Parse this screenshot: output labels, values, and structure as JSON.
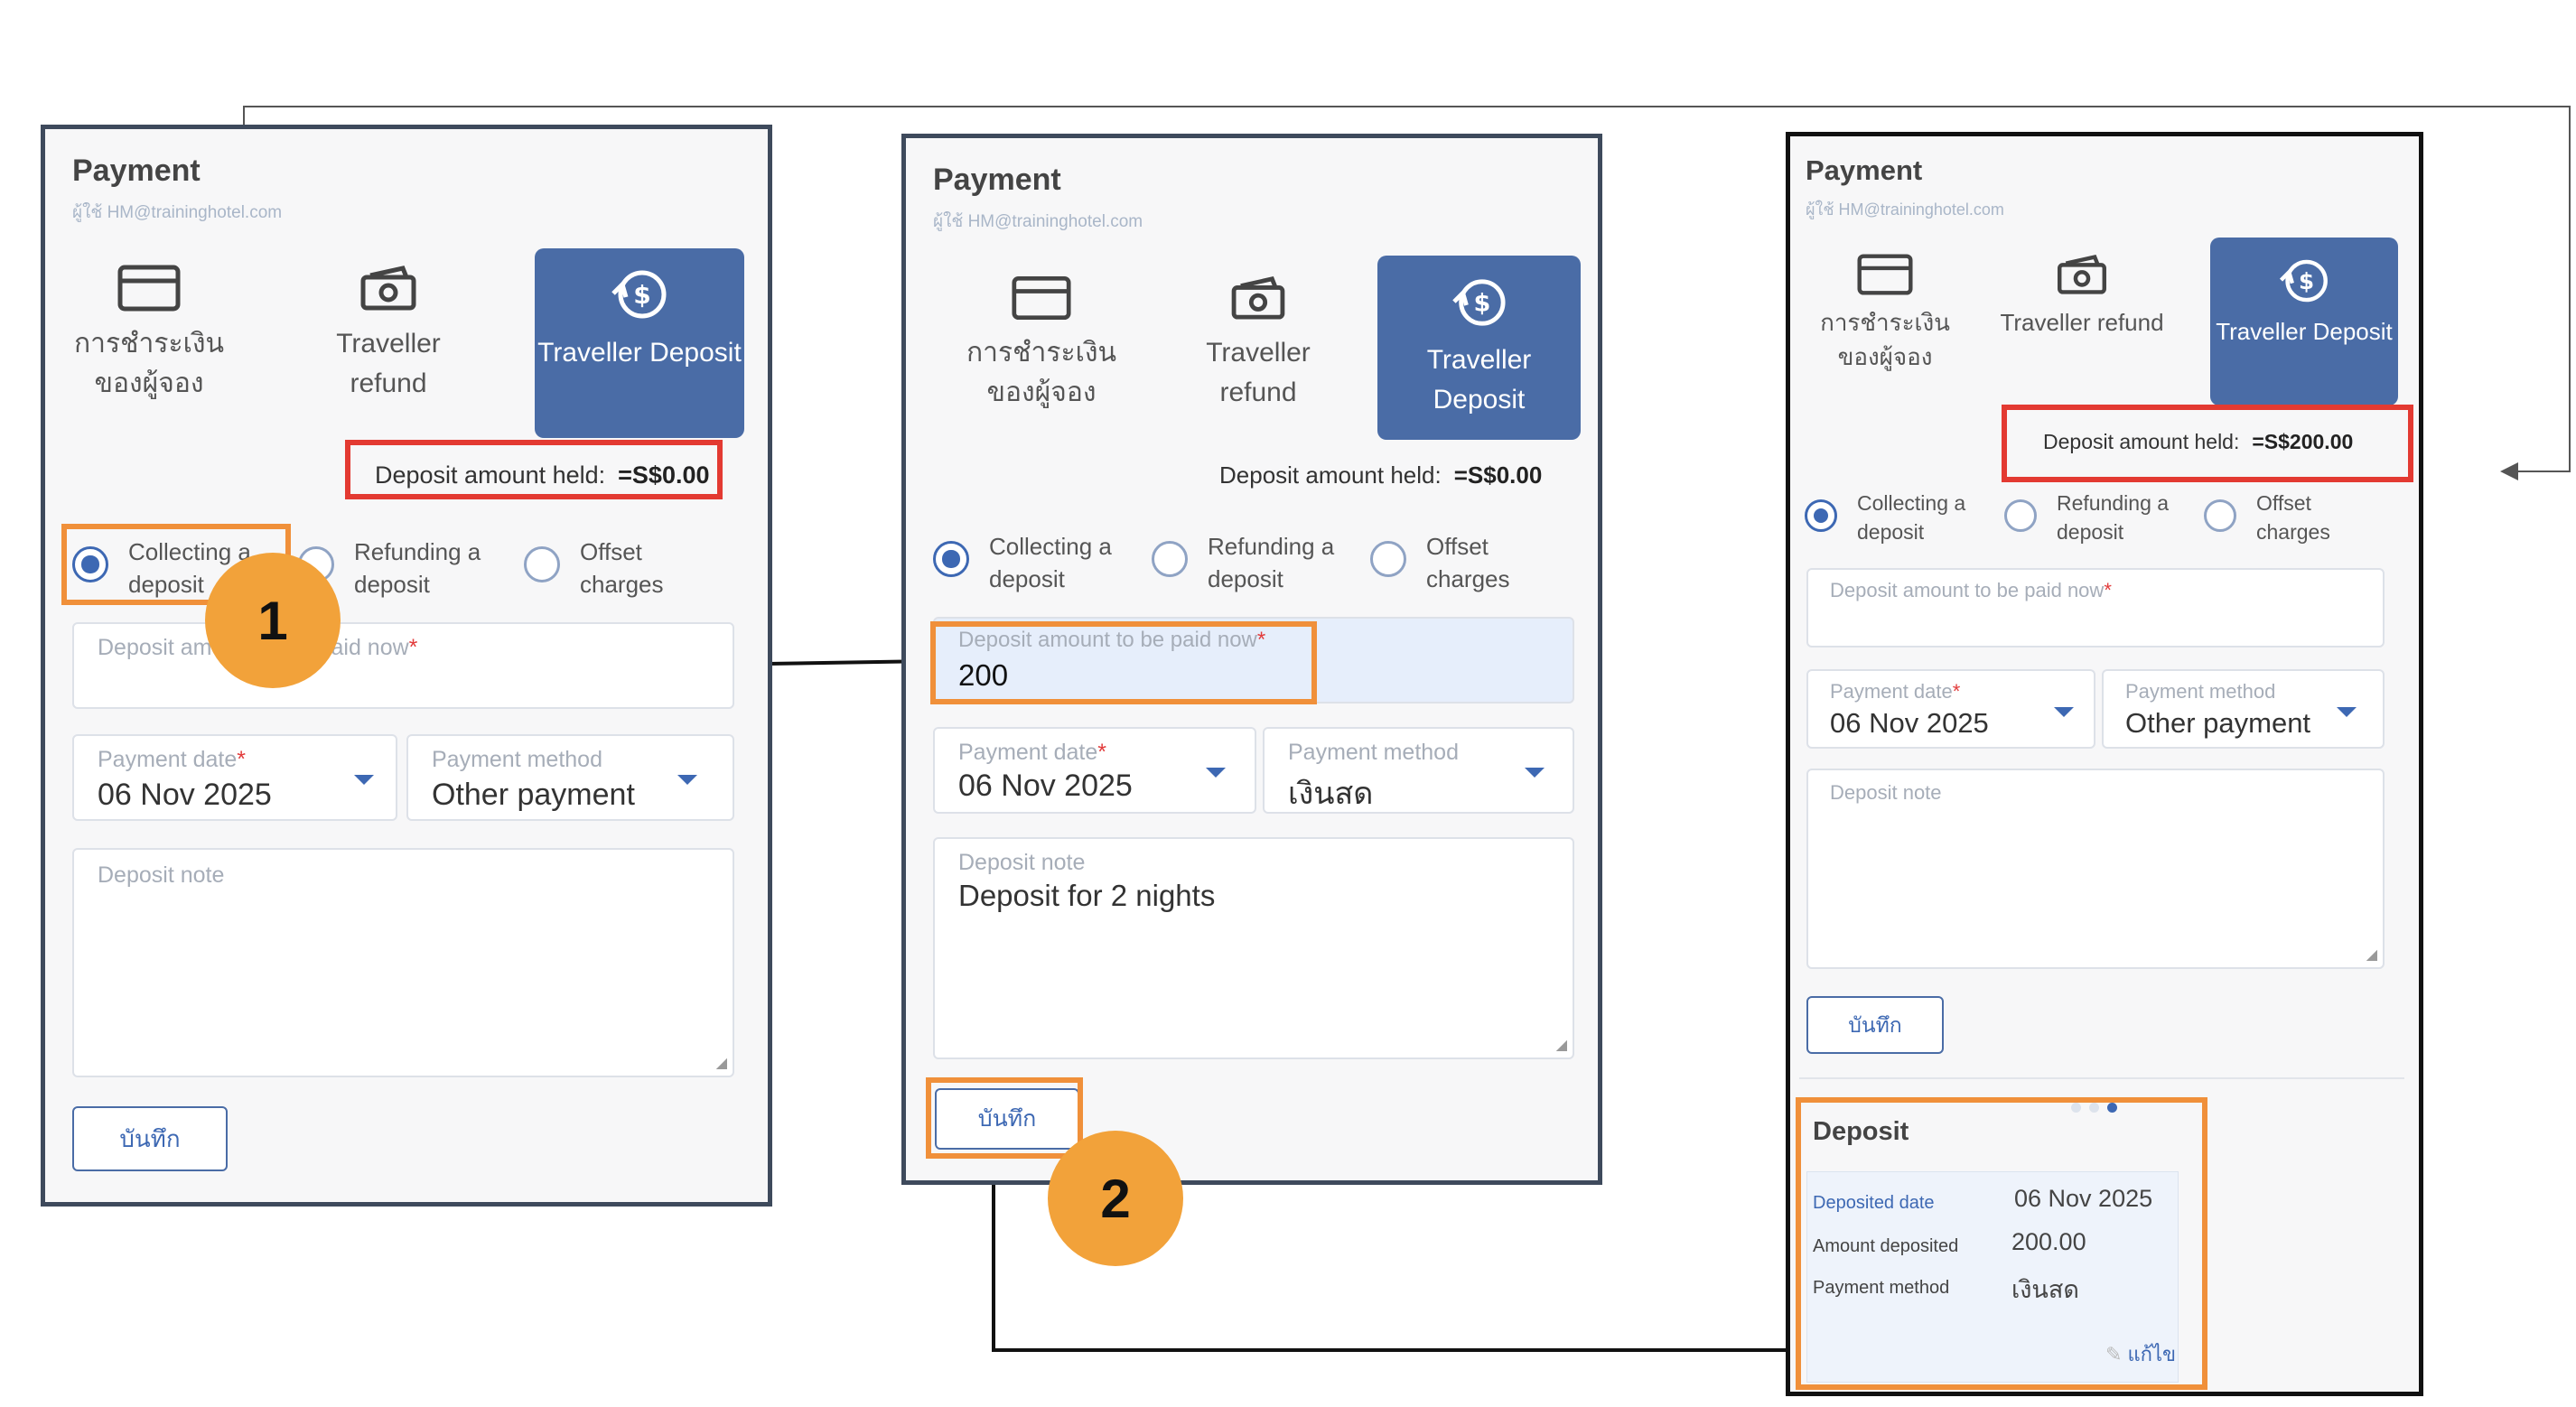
{
  "panel1": {
    "title": "Payment",
    "subtitle": "ผู้ใช้ HM@traininghotel.com",
    "tabs": [
      "การชำระเงิน ของผู้จอง",
      "Traveller refund",
      "Traveller Deposit"
    ],
    "held_label": "Deposit amount held:",
    "held_value": "=S$0.00",
    "radios": [
      "Collecting a deposit",
      "Refunding a deposit",
      "Offset charges"
    ],
    "deposit_label": "Deposit amount to be paid now",
    "deposit_value": "",
    "date_label": "Payment date",
    "date_value": "06 Nov 2025",
    "method_label": "Payment method",
    "method_value": "Other payment",
    "note_label": "Deposit note",
    "note_value": "",
    "save_label": "บันทึก"
  },
  "panel2": {
    "title": "Payment",
    "subtitle": "ผู้ใช้ HM@traininghotel.com",
    "tabs": [
      "การชำระเงิน ของผู้จอง",
      "Traveller refund",
      "Traveller Deposit"
    ],
    "held_label": "Deposit amount held:",
    "held_value": "=S$0.00",
    "radios": [
      "Collecting a deposit",
      "Refunding a deposit",
      "Offset charges"
    ],
    "deposit_label": "Deposit amount to be paid now",
    "deposit_value": "200",
    "date_label": "Payment date",
    "date_value": "06 Nov 2025",
    "method_label": "Payment method",
    "method_value": "เงินสด",
    "note_label": "Deposit note",
    "note_value": "Deposit for 2 nights",
    "save_label": "บันทึก"
  },
  "panel3": {
    "title": "Payment",
    "subtitle": "ผู้ใช้ HM@traininghotel.com",
    "tabs": [
      "การชำระเงิน ของผู้จอง",
      "Traveller refund",
      "Traveller Deposit"
    ],
    "held_label": "Deposit amount held:",
    "held_value": "=S$200.00",
    "radios": [
      "Collecting a deposit",
      "Refunding a deposit",
      "Offset charges"
    ],
    "deposit_label": "Deposit amount to be paid now",
    "deposit_value": "",
    "date_label": "Payment date",
    "date_value": "06 Nov 2025",
    "method_label": "Payment method",
    "method_value": "Other payment",
    "note_label": "Deposit note",
    "note_value": "",
    "save_label": "บันทึก",
    "deposit_section": {
      "title": "Deposit",
      "rows": [
        {
          "label": "Deposited date",
          "value": "06 Nov 2025"
        },
        {
          "label": "Amount deposited",
          "value": "200.00"
        },
        {
          "label": "Payment method",
          "value": "เงินสด"
        }
      ],
      "edit_label": "แก้ไข"
    }
  },
  "steps": [
    "1",
    "2"
  ],
  "icons": [
    "card-icon",
    "cash-icon",
    "deposit-coin-icon"
  ],
  "colors": {
    "accent": "#4a6ca6",
    "highlight_red": "#e33a32",
    "highlight_orange": "#f0903a",
    "badge": "#f2a23a"
  }
}
